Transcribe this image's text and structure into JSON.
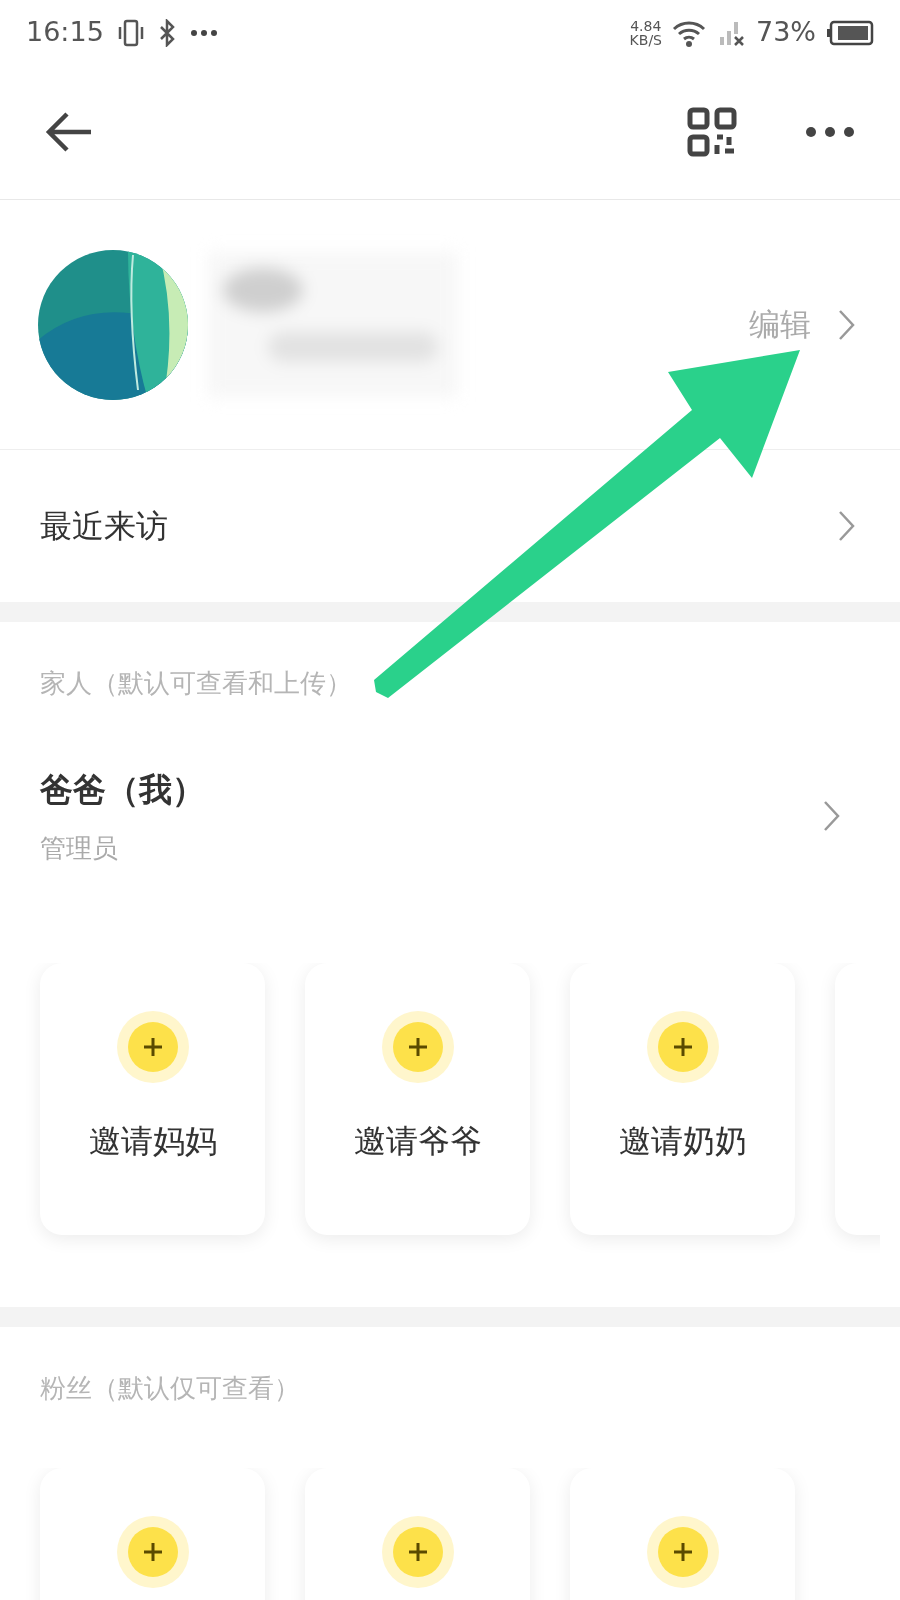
{
  "status_bar": {
    "time": "16:15",
    "speed": "4.84",
    "speed_unit": "KB/S",
    "battery": "73%"
  },
  "profile": {
    "edit_label": "编辑"
  },
  "recent_visits": {
    "label": "最近来访"
  },
  "family": {
    "title": "家人（默认可查看和上传）",
    "member": {
      "name": "爸爸（我）",
      "role": "管理员"
    },
    "cards": [
      {
        "kind": "invite",
        "label": "邀请妈妈"
      },
      {
        "kind": "invite",
        "label": "邀请爷爷"
      },
      {
        "kind": "invite",
        "label": "邀请奶奶"
      },
      {
        "kind": "partial"
      }
    ]
  },
  "fans": {
    "title": "粉丝（默认仅可查看）",
    "cards": [
      {
        "kind": "blank"
      },
      {
        "kind": "blank"
      },
      {
        "kind": "blank"
      }
    ]
  }
}
